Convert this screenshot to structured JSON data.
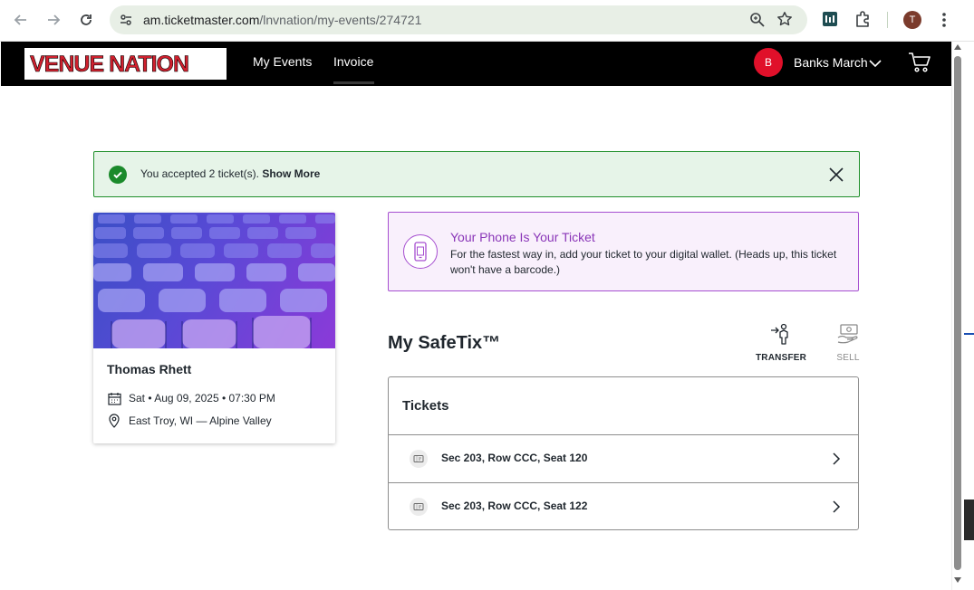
{
  "browser": {
    "url_host": "am.ticketmaster.com",
    "url_path": "/lnvnation/my-events/274721",
    "profile_initial": "T"
  },
  "header": {
    "logo_text": "VENUE NATION",
    "nav": [
      {
        "label": "My Events"
      },
      {
        "label": "Invoice"
      }
    ],
    "user_initial": "B",
    "user_name": "Banks March"
  },
  "alert": {
    "message": "You accepted 2 ticket(s).",
    "link": "Show More"
  },
  "event": {
    "title": "Thomas Rhett",
    "datetime": "Sat • Aug 09, 2025 • 07:30 PM",
    "location": "East Troy, WI — Alpine Valley"
  },
  "phone_banner": {
    "title": "Your Phone Is Your Ticket",
    "body": "For the fastest way in, add your ticket to your digital wallet. (Heads up, this ticket won't have a barcode.)"
  },
  "safetix": {
    "title": "My SafeTix™",
    "transfer_label": "TRANSFER",
    "sell_label": "SELL",
    "tickets_heading": "Tickets",
    "tickets": [
      {
        "label": "Sec 203, Row CCC, Seat 120"
      },
      {
        "label": "Sec 203, Row CCC, Seat 122"
      }
    ]
  },
  "colors": {
    "brand_red": "#d0202e",
    "success_green": "#1b8a2b",
    "accent_purple": "#a64fd0"
  },
  "icons": [
    "back-icon",
    "forward-icon",
    "reload-icon",
    "site-info-icon",
    "zoom-icon",
    "star-icon",
    "extension-icon",
    "puzzle-icon",
    "kebab-icon",
    "chevron-down-icon",
    "cart-icon",
    "check-circle-icon",
    "close-icon",
    "calendar-icon",
    "location-pin-icon",
    "phone-wallet-icon",
    "transfer-icon",
    "sell-icon",
    "ticket-icon",
    "chevron-right-icon"
  ]
}
